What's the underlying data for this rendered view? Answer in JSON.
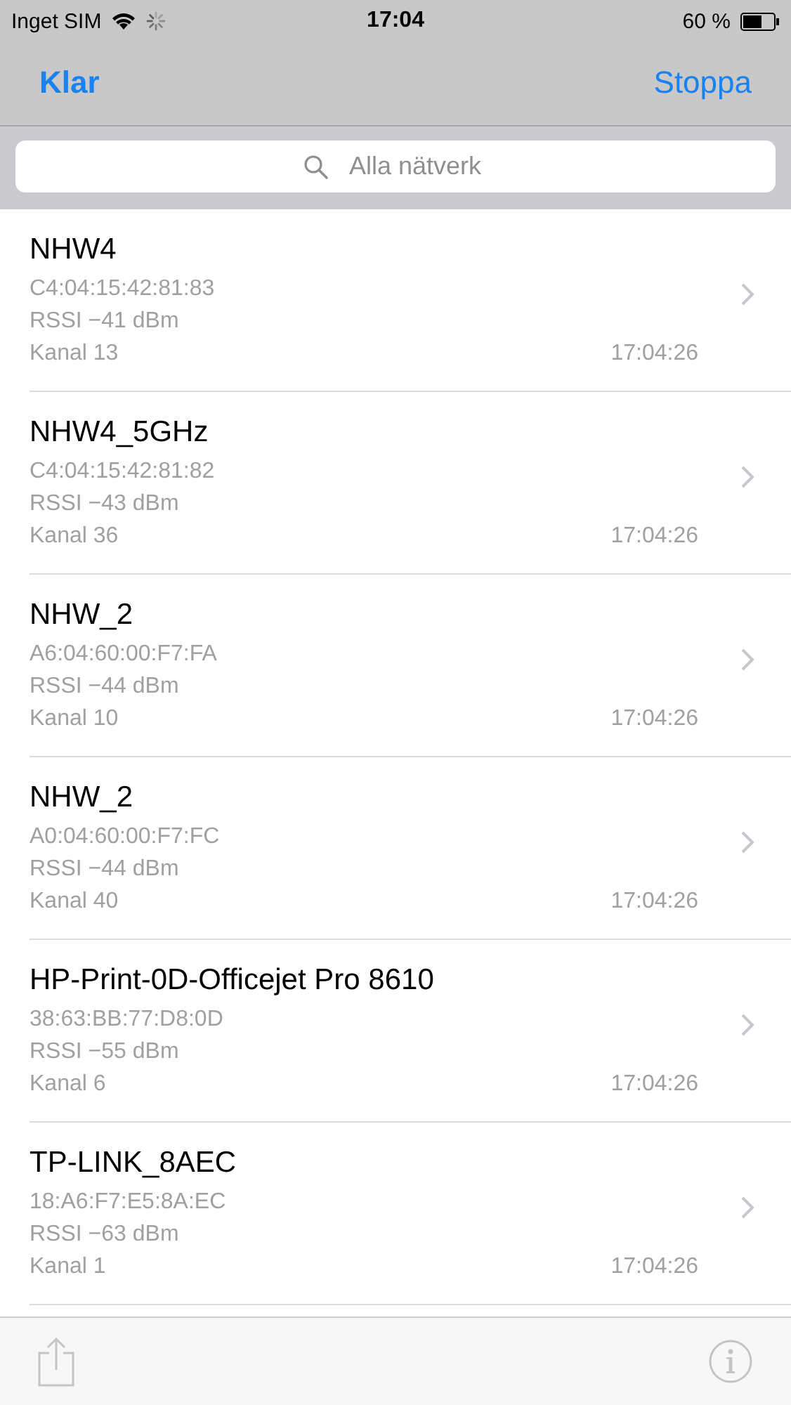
{
  "status_bar": {
    "carrier": "Inget SIM",
    "time": "17:04",
    "battery": "60 %"
  },
  "nav_bar": {
    "left_button": "Klar",
    "right_button": "Stoppa"
  },
  "search": {
    "placeholder": "Alla nätverk"
  },
  "networks": [
    {
      "name": "NHW4",
      "bssid": "C4:04:15:42:81:83",
      "rssi": "RSSI −41 dBm",
      "channel": "Kanal 13",
      "time": "17:04:26"
    },
    {
      "name": "NHW4_5GHz",
      "bssid": "C4:04:15:42:81:82",
      "rssi": "RSSI −43 dBm",
      "channel": "Kanal 36",
      "time": "17:04:26"
    },
    {
      "name": "NHW_2",
      "bssid": "A6:04:60:00:F7:FA",
      "rssi": "RSSI −44 dBm",
      "channel": "Kanal 10",
      "time": "17:04:26"
    },
    {
      "name": "NHW_2",
      "bssid": "A0:04:60:00:F7:FC",
      "rssi": "RSSI −44 dBm",
      "channel": "Kanal 40",
      "time": "17:04:26"
    },
    {
      "name": "HP-Print-0D-Officejet Pro 8610",
      "bssid": "38:63:BB:77:D8:0D",
      "rssi": "RSSI −55 dBm",
      "channel": "Kanal 6",
      "time": "17:04:26"
    },
    {
      "name": "TP-LINK_8AEC",
      "bssid": "18:A6:F7:E5:8A:EC",
      "rssi": "RSSI −63 dBm",
      "channel": "Kanal 1",
      "time": "17:04:26"
    }
  ]
}
